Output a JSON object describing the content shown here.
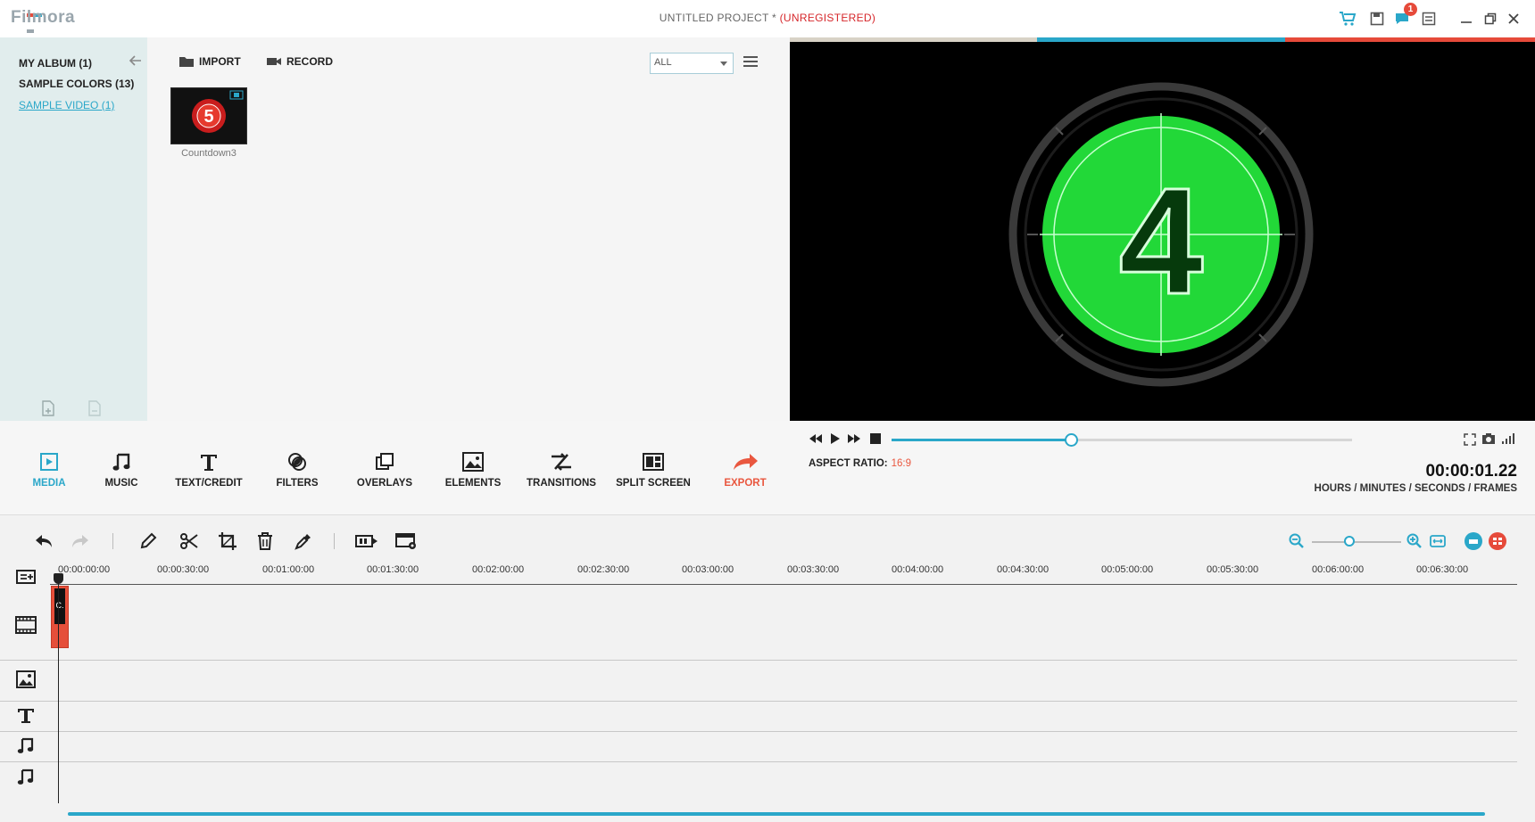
{
  "app": {
    "logo": "Filmora",
    "title": "UNTITLED PROJECT * ",
    "title_status": "(UNREGISTERED)",
    "notification_count": "1"
  },
  "sidebar": {
    "items": [
      {
        "label": "MY ALBUM (1)"
      },
      {
        "label": "SAMPLE COLORS (13)"
      },
      {
        "label": "SAMPLE VIDEO (1)"
      }
    ]
  },
  "media": {
    "import_label": "IMPORT",
    "record_label": "RECORD",
    "filter_value": "ALL",
    "thumb_label": "Countdown3",
    "thumb_number": "5"
  },
  "preview": {
    "countdown_number": "4",
    "seek_fraction": 0.39
  },
  "tools": [
    {
      "label": "MEDIA",
      "icon": "media-icon"
    },
    {
      "label": "MUSIC",
      "icon": "music-icon"
    },
    {
      "label": "TEXT/CREDIT",
      "icon": "text-icon"
    },
    {
      "label": "FILTERS",
      "icon": "filters-icon"
    },
    {
      "label": "OVERLAYS",
      "icon": "overlays-icon"
    },
    {
      "label": "ELEMENTS",
      "icon": "elements-icon"
    },
    {
      "label": "TRANSITIONS",
      "icon": "transitions-icon"
    },
    {
      "label": "SPLIT SCREEN",
      "icon": "split-screen-icon"
    },
    {
      "label": "EXPORT",
      "icon": "export-icon"
    }
  ],
  "playback": {
    "aspect_label": "ASPECT RATIO:",
    "aspect_value": "16:9",
    "timecode": "00:00:01.22",
    "timecode_label": "HOURS / MINUTES / SECONDS / FRAMES"
  },
  "timeline": {
    "ticks": [
      "00:00:00:00",
      "00:00:30:00",
      "00:01:00:00",
      "00:01:30:00",
      "00:02:00:00",
      "00:02:30:00",
      "00:03:00:00",
      "00:03:30:00",
      "00:04:00:00",
      "00:04:30:00",
      "00:05:00:00",
      "00:05:30:00",
      "00:06:00:00",
      "00:06:30:00"
    ],
    "clip_label": "C.",
    "zoom_fraction": 0.42
  },
  "colors": {
    "accent": "#2aa7c9",
    "alert": "#e9573f",
    "countdown_green": "#22d838"
  }
}
